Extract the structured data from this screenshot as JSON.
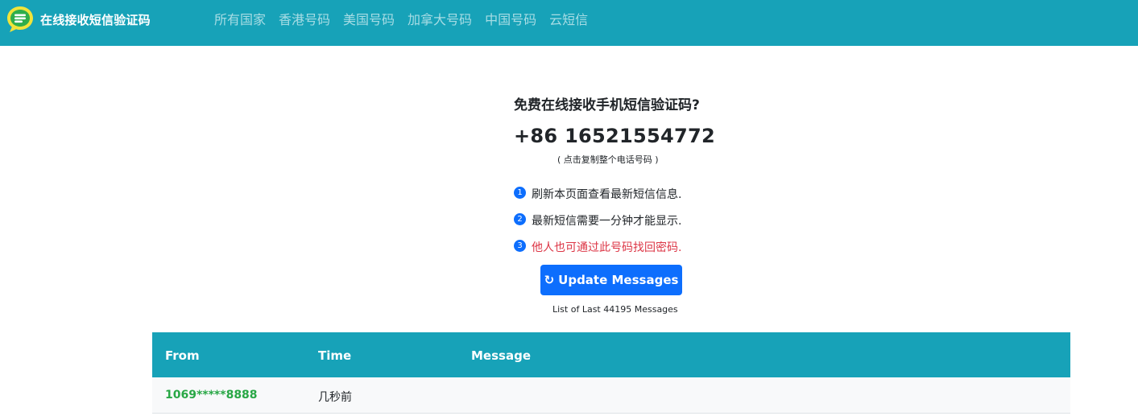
{
  "header": {
    "brand_text": "在线接收短信验证码",
    "nav": [
      "所有国家",
      "香港号码",
      "美国号码",
      "加拿大号码",
      "中国号码",
      "云短信"
    ]
  },
  "hero": {
    "title": "免费在线接收手机短信验证码?",
    "phone": "+86 16521554772",
    "copy_hint": "( 点击复制整个电话号码 )"
  },
  "tips": [
    {
      "num": "1",
      "text": "刷新本页面查看最新短信信息."
    },
    {
      "num": "2",
      "text": "最新短信需要一分钟才能显示."
    },
    {
      "num": "3",
      "text": "他人也可通过此号码找回密码."
    }
  ],
  "update_button": {
    "icon": "refresh-icon",
    "label": "Update Messages"
  },
  "message_count": "List of Last 44195 Messages",
  "table": {
    "headers": {
      "from": "From",
      "time": "Time",
      "message": "Message"
    },
    "rows": [
      {
        "from": "1069*****8888",
        "time": "几秒前",
        "message": ""
      }
    ]
  },
  "colors": {
    "navbar": "#17a2b8",
    "primary": "#0d6efd",
    "danger": "#dc3545",
    "success": "#28a745"
  }
}
